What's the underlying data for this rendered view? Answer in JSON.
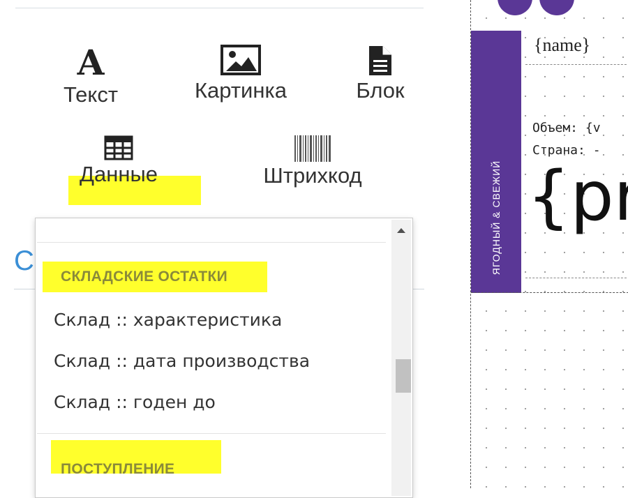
{
  "tools": {
    "text_label": "Текст",
    "image_label": "Картинка",
    "block_label": "Блок",
    "data_label": "Данные",
    "barcode_label": "Штрихкод"
  },
  "section": {
    "title_fragment": "С"
  },
  "dropdown": {
    "groups": [
      {
        "title": "СКЛАДСКИЕ ОСТАТКИ",
        "items": [
          "Склад :: характеристика",
          "Склад :: дата производства",
          "Склад :: годен до"
        ]
      },
      {
        "title": "ПОСТУПЛЕНИЕ",
        "items": []
      }
    ]
  },
  "label": {
    "brand_vertical": "ЯГОДНЫЙ & СВЕЖИЙ",
    "name_placeholder": "{name}",
    "volume_line": "Объем: {v",
    "country_line": "Страна: -",
    "price_placeholder": "{pr"
  },
  "colors": {
    "brand_purple": "#5a3796",
    "highlight": "#ffff1a",
    "group_title": "#8a8a3a",
    "link_blue": "#3b8fd6"
  },
  "icons": [
    "text-icon",
    "image-icon",
    "file-icon",
    "table-icon",
    "barcode-icon",
    "scroll-up-arrow-icon"
  ]
}
